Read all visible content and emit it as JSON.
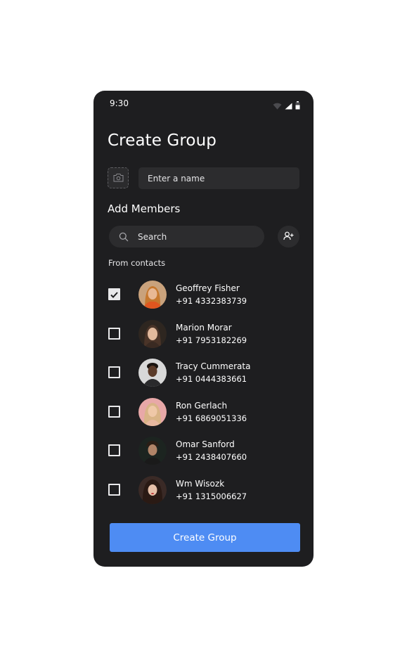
{
  "status_bar": {
    "time": "9:30",
    "icons": [
      "wifi-icon",
      "signal-icon",
      "battery-icon"
    ]
  },
  "page": {
    "title": "Create Group"
  },
  "group_name": {
    "photo_icon": "camera-icon",
    "placeholder": "Enter a name",
    "value": ""
  },
  "members": {
    "section_title": "Add Members",
    "search_placeholder": "Search",
    "search_icon": "search-icon",
    "add_member_icon": "add-person-icon",
    "contacts_label": "From contacts",
    "contacts": [
      {
        "name": "Geoffrey Fisher",
        "phone": "+91 4332383739",
        "checked": true
      },
      {
        "name": "Marion Morar",
        "phone": "+91 7953182269",
        "checked": false
      },
      {
        "name": "Tracy Cummerata",
        "phone": "+91 0444383661",
        "checked": false
      },
      {
        "name": "Ron Gerlach",
        "phone": "+91 6869051336",
        "checked": false
      },
      {
        "name": "Omar Sanford",
        "phone": "+91 2438407660",
        "checked": false
      },
      {
        "name": "Wm Wisozk",
        "phone": "+91 1315006627",
        "checked": false
      }
    ]
  },
  "actions": {
    "create_label": "Create Group"
  },
  "colors": {
    "background": "#1e1e20",
    "surface": "#2c2c2e",
    "accent": "#4e8cf3",
    "text": "#ffffff"
  }
}
